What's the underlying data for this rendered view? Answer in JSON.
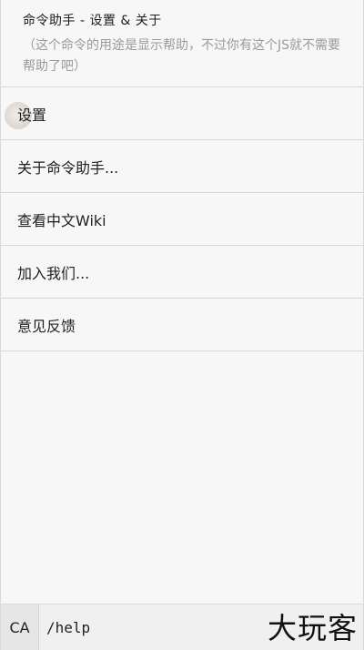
{
  "header": {
    "title": "命令助手 - 设置 & 关于",
    "subtitle": "（这个命令的用途是显示帮助，不过你有这个JS就不需要帮助了吧）"
  },
  "menu": {
    "items": [
      {
        "label": "设置"
      },
      {
        "label": "关于命令助手..."
      },
      {
        "label": "查看中文Wiki"
      },
      {
        "label": "加入我们..."
      },
      {
        "label": "意见反馈"
      }
    ]
  },
  "bottom_bar": {
    "ca_label": "CA",
    "command_value": "/help"
  },
  "watermark": {
    "text": "大玩客"
  }
}
